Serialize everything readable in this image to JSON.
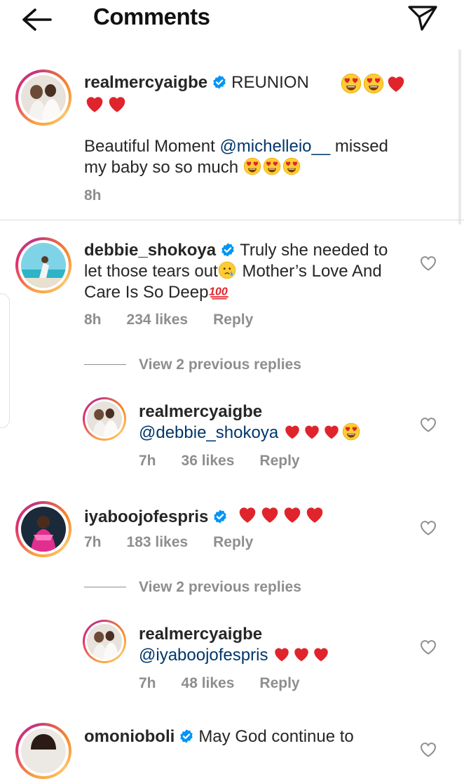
{
  "header": {
    "title": "Comments"
  },
  "caption": {
    "username": "realmercyaigbe",
    "text1": "REUNION",
    "line2_prefix": "Beautiful Moment ",
    "mention": "@michelleio__",
    "line2_suffix": " missed",
    "line3": "my baby so so much",
    "time": "8h"
  },
  "comments": [
    {
      "username": "debbie_shokoya",
      "text_a": "Truly she needed to",
      "text_b": "let those tears out",
      "text_c": " Mother’s Love And",
      "text_d": "Care Is So Deep",
      "time": "8h",
      "likes": "234 likes",
      "reply": "Reply",
      "view_replies": "View 2 previous replies",
      "sub": {
        "username": "realmercyaigbe",
        "mention": "@debbie_shokoya",
        "time": "7h",
        "likes": "36 likes",
        "reply": "Reply"
      }
    },
    {
      "username": "iyaboojofespris",
      "time": "7h",
      "likes": "183 likes",
      "reply": "Reply",
      "view_replies": "View 2 previous replies",
      "sub": {
        "username": "realmercyaigbe",
        "mention": "@iyaboojofespris",
        "time": "7h",
        "likes": "48 likes",
        "reply": "Reply"
      }
    },
    {
      "username": "omonioboli",
      "text": "May God continue to"
    }
  ],
  "colors": {
    "verified": "#0095f6",
    "mention": "#00376b",
    "meta": "#8e8e8e",
    "heart_red": "#e0242c"
  },
  "icons": [
    "back-arrow-icon",
    "send-icon",
    "verified-badge-icon",
    "heart-outline-icon",
    "heart-eyes-emoji",
    "red-heart-emoji",
    "crying-face-emoji",
    "hundred-points-emoji"
  ]
}
